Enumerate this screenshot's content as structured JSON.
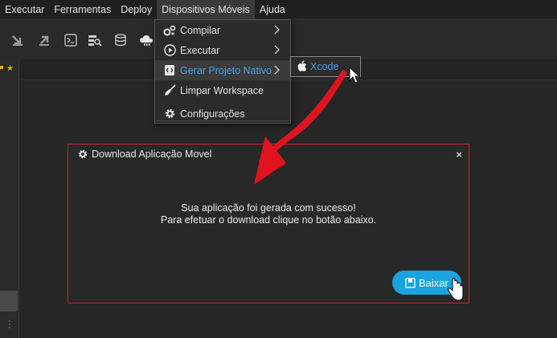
{
  "menubar": {
    "items": [
      "Executar",
      "Ferramentas",
      "Deploy",
      "Dispositivos Móveis",
      "Ajuda"
    ],
    "active": "Dispositivos Móveis"
  },
  "toolbar": {
    "icons": [
      "import-icon",
      "export-icon",
      "terminal-icon",
      "search-server-icon",
      "database-icon",
      "cloud-icon"
    ]
  },
  "dropdown": {
    "items": [
      {
        "label": "Compilar",
        "icon": "gears-icon",
        "submenu": true
      },
      {
        "label": "Executar",
        "icon": "play-circle-icon",
        "submenu": true
      },
      {
        "label": "Gerar Projeto Nativo",
        "icon": "code-file-icon",
        "submenu": true,
        "highlighted": true
      },
      {
        "label": "Limpar Workspace",
        "icon": "broom-icon",
        "submenu": false
      },
      {
        "label": "Configurações",
        "icon": "gear-icon",
        "submenu": false
      }
    ]
  },
  "submenu": {
    "label": "Xcode",
    "icon": "apple-icon"
  },
  "dialog": {
    "title": "Download Aplicação Movel",
    "close": "×",
    "message_line1": "Sua aplicação foi gerada com sucesso!",
    "message_line2": "Para efetuar o download clique no botão abaixo.",
    "button_label": "Baixar"
  },
  "colors": {
    "accent": "#1aa3df",
    "highlight_text": "#4a9fdf",
    "dialog_border": "#d0202a",
    "annotation_arrow": "#e0141e"
  }
}
